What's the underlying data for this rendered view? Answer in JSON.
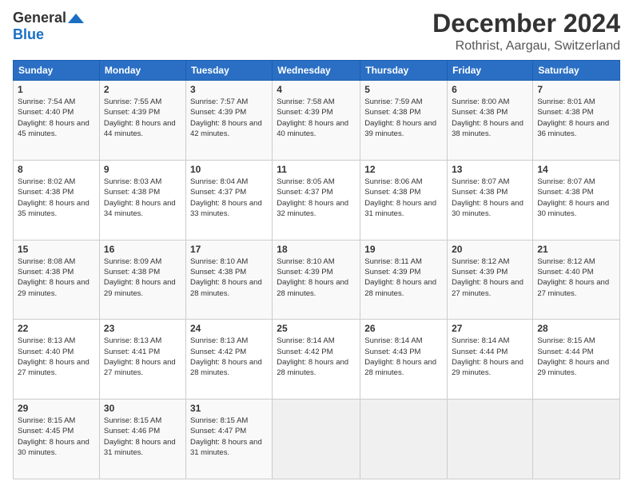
{
  "header": {
    "logo": {
      "general": "General",
      "blue": "Blue"
    },
    "title": "December 2024",
    "location": "Rothrist, Aargau, Switzerland"
  },
  "days_of_week": [
    "Sunday",
    "Monday",
    "Tuesday",
    "Wednesday",
    "Thursday",
    "Friday",
    "Saturday"
  ],
  "weeks": [
    [
      {
        "day": "1",
        "sunrise": "7:54 AM",
        "sunset": "4:40 PM",
        "daylight": "8 hours and 45 minutes."
      },
      {
        "day": "2",
        "sunrise": "7:55 AM",
        "sunset": "4:39 PM",
        "daylight": "8 hours and 44 minutes."
      },
      {
        "day": "3",
        "sunrise": "7:57 AM",
        "sunset": "4:39 PM",
        "daylight": "8 hours and 42 minutes."
      },
      {
        "day": "4",
        "sunrise": "7:58 AM",
        "sunset": "4:39 PM",
        "daylight": "8 hours and 40 minutes."
      },
      {
        "day": "5",
        "sunrise": "7:59 AM",
        "sunset": "4:38 PM",
        "daylight": "8 hours and 39 minutes."
      },
      {
        "day": "6",
        "sunrise": "8:00 AM",
        "sunset": "4:38 PM",
        "daylight": "8 hours and 38 minutes."
      },
      {
        "day": "7",
        "sunrise": "8:01 AM",
        "sunset": "4:38 PM",
        "daylight": "8 hours and 36 minutes."
      }
    ],
    [
      {
        "day": "8",
        "sunrise": "8:02 AM",
        "sunset": "4:38 PM",
        "daylight": "8 hours and 35 minutes."
      },
      {
        "day": "9",
        "sunrise": "8:03 AM",
        "sunset": "4:38 PM",
        "daylight": "8 hours and 34 minutes."
      },
      {
        "day": "10",
        "sunrise": "8:04 AM",
        "sunset": "4:37 PM",
        "daylight": "8 hours and 33 minutes."
      },
      {
        "day": "11",
        "sunrise": "8:05 AM",
        "sunset": "4:37 PM",
        "daylight": "8 hours and 32 minutes."
      },
      {
        "day": "12",
        "sunrise": "8:06 AM",
        "sunset": "4:38 PM",
        "daylight": "8 hours and 31 minutes."
      },
      {
        "day": "13",
        "sunrise": "8:07 AM",
        "sunset": "4:38 PM",
        "daylight": "8 hours and 30 minutes."
      },
      {
        "day": "14",
        "sunrise": "8:07 AM",
        "sunset": "4:38 PM",
        "daylight": "8 hours and 30 minutes."
      }
    ],
    [
      {
        "day": "15",
        "sunrise": "8:08 AM",
        "sunset": "4:38 PM",
        "daylight": "8 hours and 29 minutes."
      },
      {
        "day": "16",
        "sunrise": "8:09 AM",
        "sunset": "4:38 PM",
        "daylight": "8 hours and 29 minutes."
      },
      {
        "day": "17",
        "sunrise": "8:10 AM",
        "sunset": "4:38 PM",
        "daylight": "8 hours and 28 minutes."
      },
      {
        "day": "18",
        "sunrise": "8:10 AM",
        "sunset": "4:39 PM",
        "daylight": "8 hours and 28 minutes."
      },
      {
        "day": "19",
        "sunrise": "8:11 AM",
        "sunset": "4:39 PM",
        "daylight": "8 hours and 28 minutes."
      },
      {
        "day": "20",
        "sunrise": "8:12 AM",
        "sunset": "4:39 PM",
        "daylight": "8 hours and 27 minutes."
      },
      {
        "day": "21",
        "sunrise": "8:12 AM",
        "sunset": "4:40 PM",
        "daylight": "8 hours and 27 minutes."
      }
    ],
    [
      {
        "day": "22",
        "sunrise": "8:13 AM",
        "sunset": "4:40 PM",
        "daylight": "8 hours and 27 minutes."
      },
      {
        "day": "23",
        "sunrise": "8:13 AM",
        "sunset": "4:41 PM",
        "daylight": "8 hours and 27 minutes."
      },
      {
        "day": "24",
        "sunrise": "8:13 AM",
        "sunset": "4:42 PM",
        "daylight": "8 hours and 28 minutes."
      },
      {
        "day": "25",
        "sunrise": "8:14 AM",
        "sunset": "4:42 PM",
        "daylight": "8 hours and 28 minutes."
      },
      {
        "day": "26",
        "sunrise": "8:14 AM",
        "sunset": "4:43 PM",
        "daylight": "8 hours and 28 minutes."
      },
      {
        "day": "27",
        "sunrise": "8:14 AM",
        "sunset": "4:44 PM",
        "daylight": "8 hours and 29 minutes."
      },
      {
        "day": "28",
        "sunrise": "8:15 AM",
        "sunset": "4:44 PM",
        "daylight": "8 hours and 29 minutes."
      }
    ],
    [
      {
        "day": "29",
        "sunrise": "8:15 AM",
        "sunset": "4:45 PM",
        "daylight": "8 hours and 30 minutes."
      },
      {
        "day": "30",
        "sunrise": "8:15 AM",
        "sunset": "4:46 PM",
        "daylight": "8 hours and 31 minutes."
      },
      {
        "day": "31",
        "sunrise": "8:15 AM",
        "sunset": "4:47 PM",
        "daylight": "8 hours and 31 minutes."
      },
      null,
      null,
      null,
      null
    ]
  ],
  "labels": {
    "sunrise": "Sunrise:",
    "sunset": "Sunset:",
    "daylight": "Daylight:"
  }
}
